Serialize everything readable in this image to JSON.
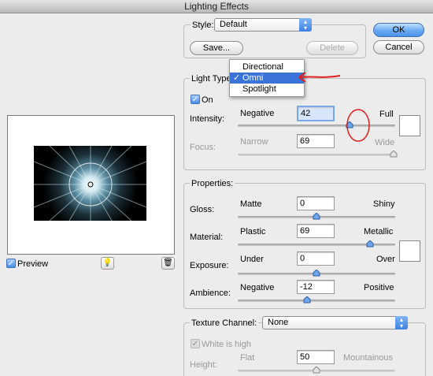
{
  "window": {
    "title": "Lighting Effects"
  },
  "style": {
    "label": "Style:",
    "selected": "Default",
    "save_label": "Save...",
    "delete_label": "Delete"
  },
  "dialog": {
    "ok_label": "OK",
    "cancel_label": "Cancel"
  },
  "light_type": {
    "label": "Light Type:",
    "menu": [
      {
        "label": "Directional",
        "selected": false
      },
      {
        "label": "Omni",
        "selected": true
      },
      {
        "label": "Spotlight",
        "selected": false
      }
    ],
    "checkmark": "✓",
    "on_label": "On",
    "on_checked": true,
    "intensity": {
      "label": "Intensity:",
      "min_label": "Negative",
      "max_label": "Full",
      "value": "42",
      "level": 0.71
    },
    "focus": {
      "label": "Focus:",
      "min_label": "Narrow",
      "max_label": "Wide",
      "value": "69",
      "level": 0.99
    }
  },
  "properties": {
    "label": "Properties:",
    "gloss": {
      "label": "Gloss:",
      "min_label": "Matte",
      "max_label": "Shiny",
      "value": "0",
      "level": 0.5
    },
    "material": {
      "label": "Material:",
      "min_label": "Plastic",
      "max_label": "Metallic",
      "value": "69",
      "level": 0.84
    },
    "exposure": {
      "label": "Exposure:",
      "min_label": "Under",
      "max_label": "Over",
      "value": "0",
      "level": 0.5
    },
    "ambience": {
      "label": "Ambience:",
      "min_label": "Negative",
      "max_label": "Positive",
      "value": "-12",
      "level": 0.44
    }
  },
  "texture": {
    "label": "Texture Channel:",
    "selected": "None",
    "white_is_high_label": "White is high",
    "height": {
      "label": "Height:",
      "min_label": "Flat",
      "max_label": "Mountainous",
      "value": "50",
      "level": 0.5
    }
  },
  "preview": {
    "label": "Preview",
    "checked": true
  },
  "colors": {
    "accent": "#3a74d8",
    "annotation_red": "#e02020",
    "swatch": "#ffffff"
  }
}
